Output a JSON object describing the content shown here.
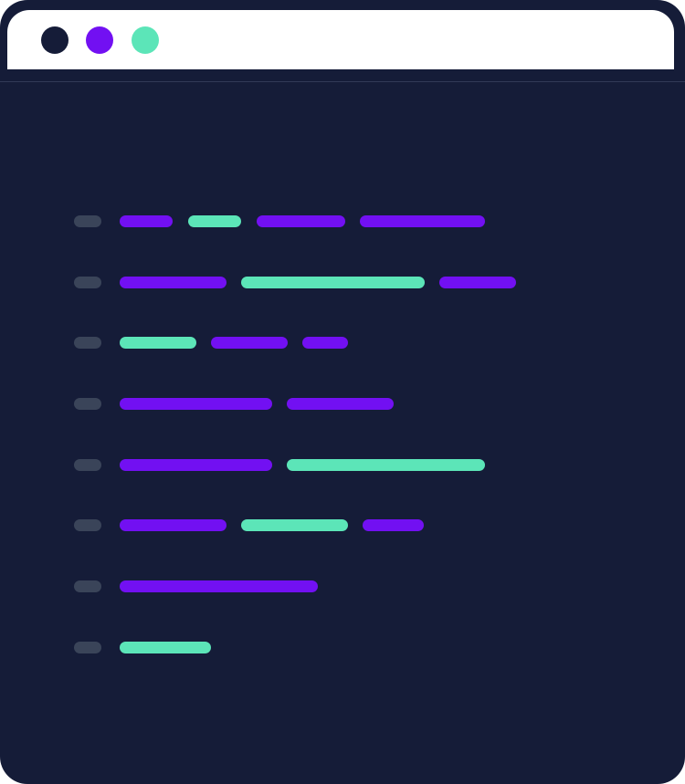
{
  "colors": {
    "frame": "#151c38",
    "titlebar": "#ffffff",
    "divider": "#323a57",
    "purple": "#7210f2",
    "mint": "#5ce5b8",
    "gutter": "#3a4459"
  },
  "window_controls": [
    {
      "name": "close-dot",
      "color": "#151c38"
    },
    {
      "name": "minimize-dot",
      "color": "#7210f2"
    },
    {
      "name": "maximize-dot",
      "color": "#5ce5b8"
    }
  ],
  "code_lines": [
    {
      "segments": [
        "purple",
        "mint",
        "purple",
        "purple"
      ]
    },
    {
      "segments": [
        "purple",
        "mint",
        "purple"
      ]
    },
    {
      "segments": [
        "mint",
        "purple",
        "purple"
      ]
    },
    {
      "segments": [
        "purple",
        "purple"
      ]
    },
    {
      "segments": [
        "purple",
        "mint"
      ]
    },
    {
      "segments": [
        "purple",
        "mint",
        "purple"
      ]
    },
    {
      "segments": [
        "purple"
      ]
    },
    {
      "segments": [
        "mint"
      ]
    }
  ]
}
